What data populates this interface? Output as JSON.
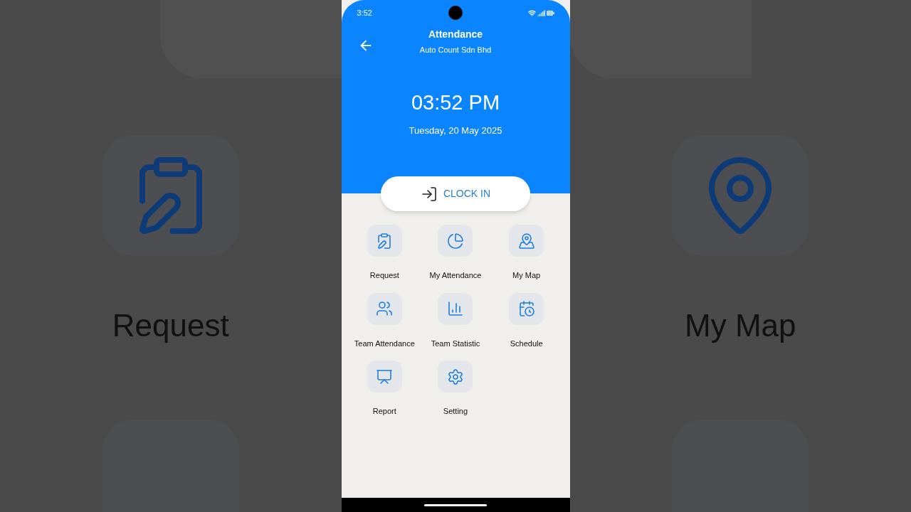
{
  "background": {
    "left_label": "Request",
    "right_label": "My Map"
  },
  "status_bar": {
    "time": "3:52"
  },
  "header": {
    "title": "Attendance",
    "subtitle": "Auto Count Sdn Bhd"
  },
  "clock": {
    "time": "03:52 PM",
    "date": "Tuesday, 20 May 2025"
  },
  "clock_button": {
    "label": "CLOCK IN"
  },
  "menu": [
    {
      "label": "Request"
    },
    {
      "label": "My Attendance"
    },
    {
      "label": "My Map"
    },
    {
      "label": "Team Attendance"
    },
    {
      "label": "Team Statistic"
    },
    {
      "label": "Schedule"
    },
    {
      "label": "Report"
    },
    {
      "label": "Setting"
    }
  ]
}
